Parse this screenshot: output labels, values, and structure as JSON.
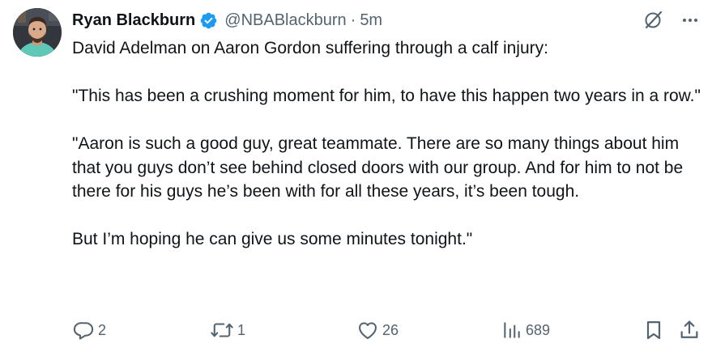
{
  "author": {
    "name": "Ryan Blackburn",
    "handle": "@NBABlackburn",
    "separator": "·",
    "time": "5m",
    "verified_icon": "verified-badge-icon"
  },
  "tweet": {
    "paragraphs": [
      "David Adelman on Aaron Gordon suffering through a calf injury:",
      "\"This has been a crushing moment for him, to have this happen two years in a row.\"",
      "\"Aaron is such a good guy, great teammate. There are so many things about him that you guys don’t see behind closed doors with our group. And for him to not be there for his guys he’s been with for all these years, it’s been tough.",
      "But I’m hoping he can give us some minutes tonight.\""
    ]
  },
  "top_icons": [
    "grok-icon",
    "more-icon"
  ],
  "actions": {
    "reply_count": "2",
    "retweet_count": "1",
    "like_count": "26",
    "views_count": "689"
  },
  "colors": {
    "text": "#0f1419",
    "secondary": "#536471",
    "verified": "#1d9bf0"
  }
}
